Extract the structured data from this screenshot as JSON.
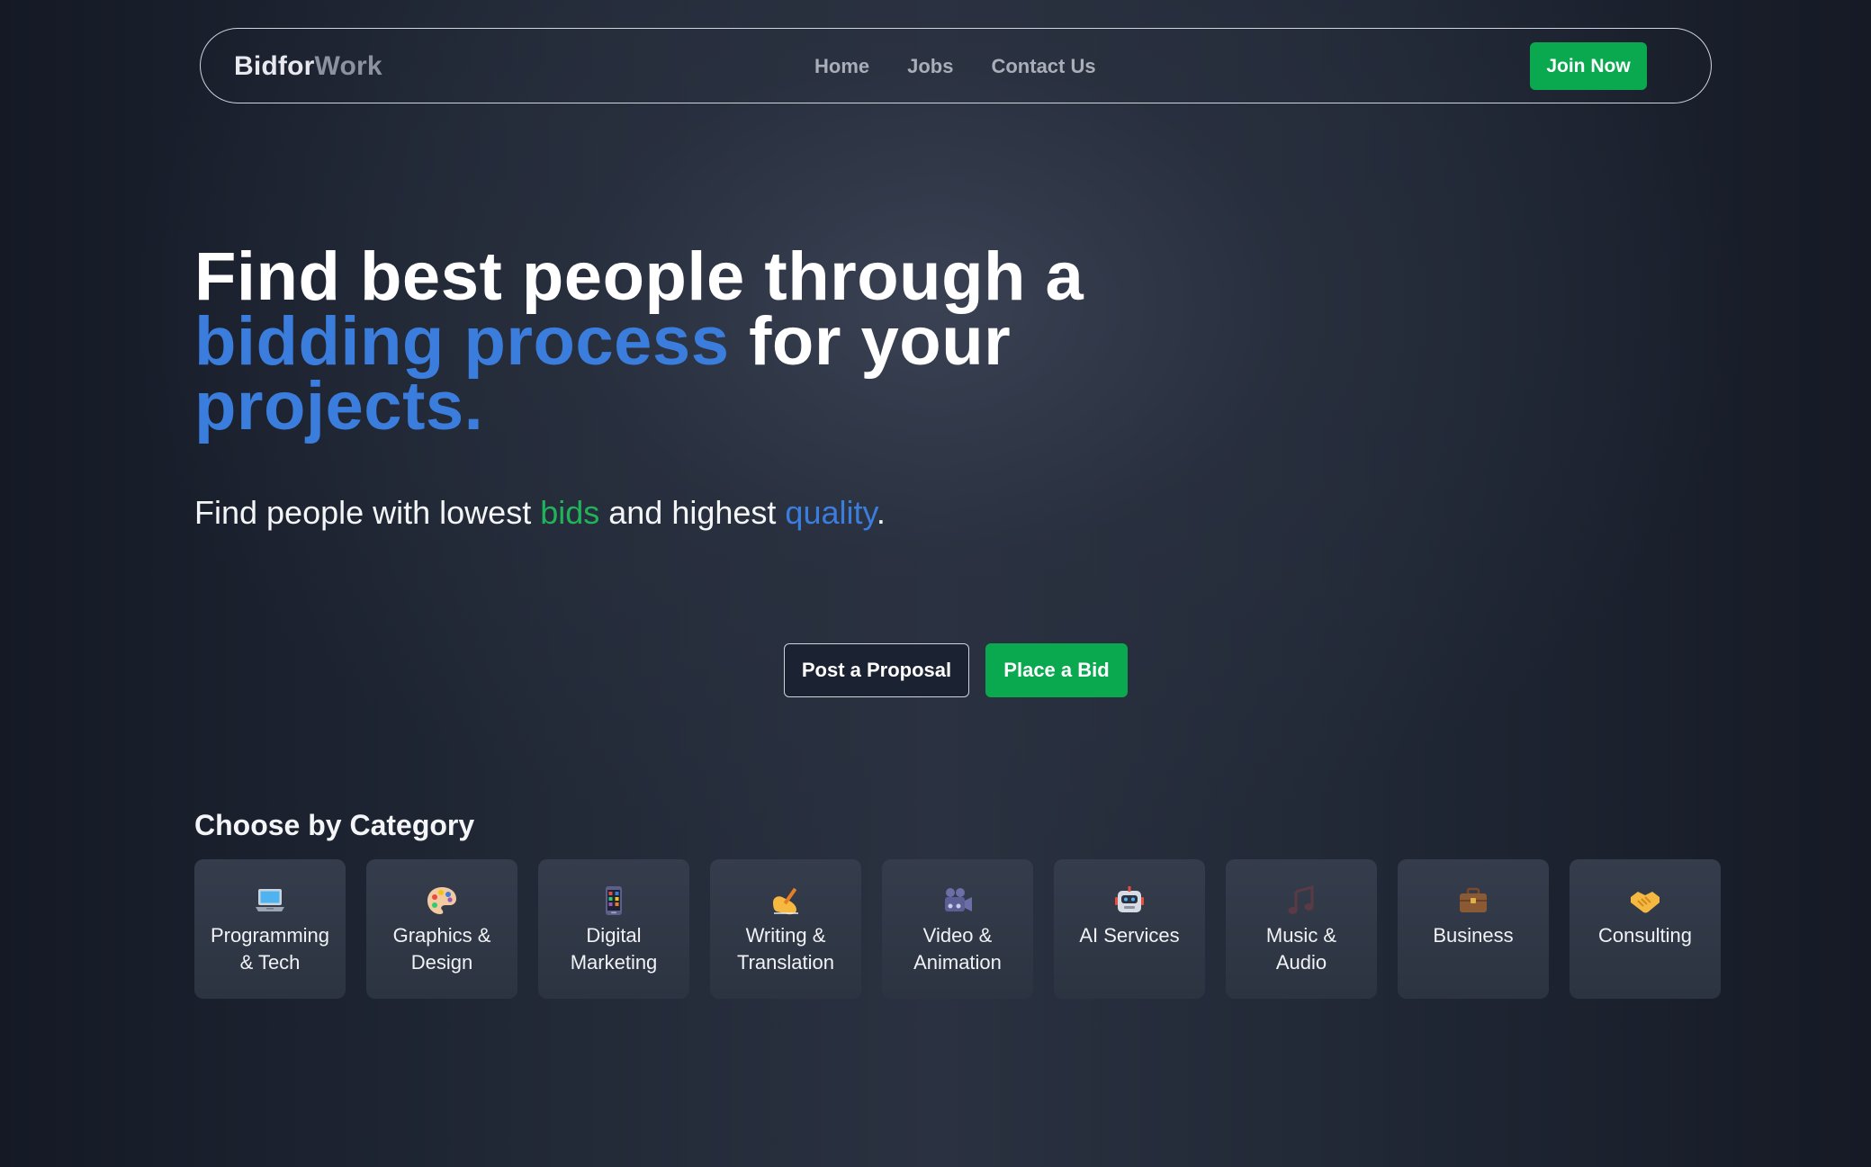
{
  "brand": {
    "part1": "Bidfor",
    "part2": "Work"
  },
  "nav": {
    "links": [
      {
        "label": "Home"
      },
      {
        "label": "Jobs"
      },
      {
        "label": "Contact Us"
      }
    ],
    "join_label": "Join Now"
  },
  "hero": {
    "title": {
      "line1": "Find best people through a",
      "highlight1": "bidding process",
      "mid": " for your",
      "highlight2": "projects."
    },
    "subtitle": {
      "part1": "Find people with lowest ",
      "green_word": "bids",
      "part2": " and highest ",
      "blue_word": "quality",
      "part3": "."
    }
  },
  "cta": {
    "proposal_label": "Post a Proposal",
    "bid_label": "Place a Bid"
  },
  "categories": {
    "heading": "Choose by Category",
    "items": [
      {
        "line1": "Programming",
        "line2": "& Tech",
        "icon": "laptop-icon"
      },
      {
        "line1": "Graphics &",
        "line2": "Design",
        "icon": "palette-icon"
      },
      {
        "line1": "Digital",
        "line2": "Marketing",
        "icon": "phone-icon"
      },
      {
        "line1": "Writing &",
        "line2": "Translation",
        "icon": "writing-hand-icon"
      },
      {
        "line1": "Video &",
        "line2": "Animation",
        "icon": "video-camera-icon"
      },
      {
        "line1": "AI Services",
        "line2": "",
        "icon": "robot-icon"
      },
      {
        "line1": "Music &",
        "line2": "Audio",
        "icon": "music-note-icon"
      },
      {
        "line1": "Business",
        "line2": "",
        "icon": "briefcase-icon"
      },
      {
        "line1": "Consulting",
        "line2": "",
        "icon": "handshake-icon"
      }
    ]
  },
  "colors": {
    "accent_blue": "#3b7ddd",
    "accent_green": "#0aa84f",
    "text_green": "#21b35a"
  }
}
